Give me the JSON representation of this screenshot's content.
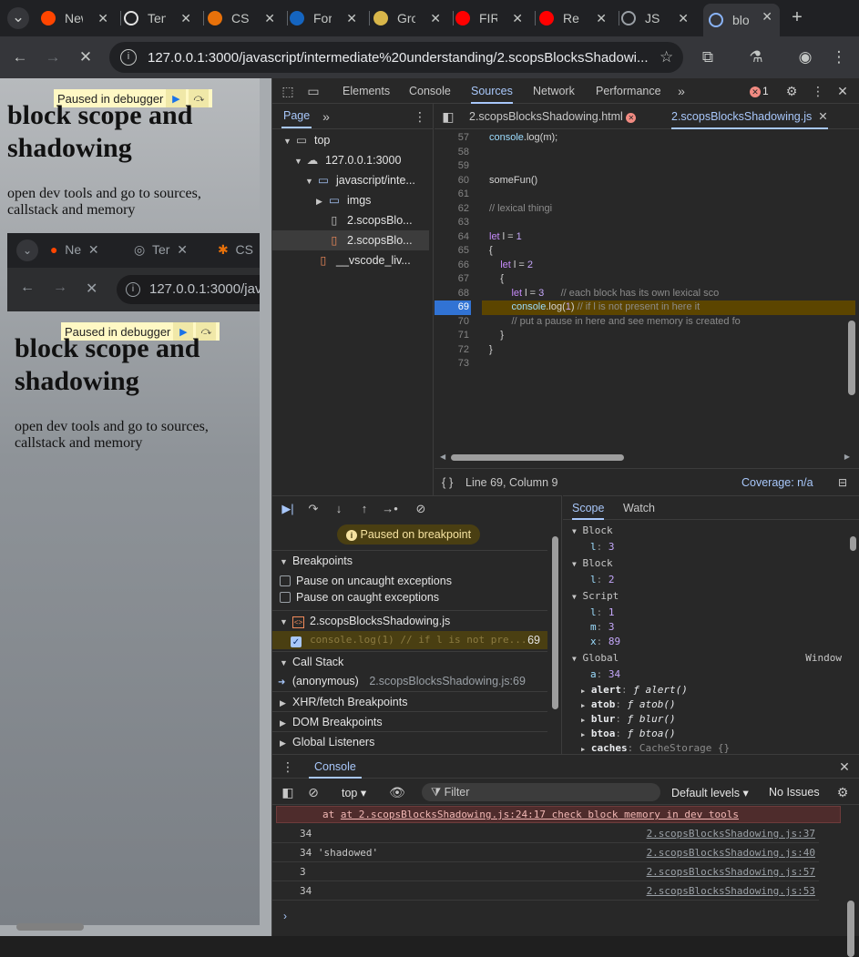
{
  "browser": {
    "tabs": [
      {
        "label": "New Tab",
        "fav": "reddit-icon",
        "color": "#ff4500"
      },
      {
        "label": "Ten",
        "fav": "openai-icon",
        "color": "#e3e3e3"
      },
      {
        "label": "CS",
        "fav": "asterisk-icon",
        "color": "#e8710a"
      },
      {
        "label": "For",
        "fav": "fs-icon",
        "color": "#1565c0"
      },
      {
        "label": "Gro",
        "fav": "bee-icon",
        "color": "#d8b64a"
      },
      {
        "label": "FIR",
        "fav": "youtube-icon",
        "color": "#ff0000"
      },
      {
        "label": "Re",
        "fav": "youtube-icon",
        "color": "#ff0000"
      },
      {
        "label": "JS",
        "fav": "globe-icon",
        "color": "#9aa0a6"
      },
      {
        "label": "blo",
        "fav": "loading-icon",
        "color": "#8ab4f8"
      }
    ],
    "url": "127.0.0.1:3000/javascript/intermediate%20understanding/2.scopsBlocksShadowi..."
  },
  "page": {
    "paused_banner": "Paused in debugger",
    "heading": "block scope and shadowing",
    "paragraph": "open dev tools and go to sources, callstack and memory",
    "nested_tabs": [
      "Ne",
      "Ter",
      "CS"
    ],
    "nested_url": "127.0.0.1:3000/jav"
  },
  "devtools": {
    "tabs": [
      "Elements",
      "Console",
      "Sources",
      "Network",
      "Performance"
    ],
    "active_tab": "Sources",
    "error_count": "1",
    "navigator": {
      "tab": "Page",
      "tree": [
        {
          "label": "top",
          "icon": "frame-icon",
          "depth": 0,
          "expanded": true
        },
        {
          "label": "127.0.0.1:3000",
          "icon": "cloud-icon",
          "depth": 1,
          "expanded": true
        },
        {
          "label": "javascript/inte...",
          "icon": "folder-icon",
          "depth": 2,
          "expanded": true
        },
        {
          "label": "imgs",
          "icon": "folder-icon",
          "depth": 3,
          "expanded": false
        },
        {
          "label": "2.scopsBlo...",
          "icon": "file-icon",
          "depth": 3
        },
        {
          "label": "2.scopsBlo...",
          "icon": "js-file-icon",
          "depth": 3,
          "selected": true
        },
        {
          "label": "__vscode_liv...",
          "icon": "js-file-icon",
          "depth": 2
        }
      ]
    },
    "editor": {
      "tabs": [
        "2.scopsBlocksShadowing.html",
        "2.scopsBlocksShadowing.js"
      ],
      "active_tab": "2.scopsBlocksShadowing.js",
      "lines": [
        {
          "n": "57",
          "code": "console.log(m);"
        },
        {
          "n": "58",
          "code": ""
        },
        {
          "n": "59",
          "code": ""
        },
        {
          "n": "60",
          "code": "someFun()"
        },
        {
          "n": "61",
          "code": ""
        },
        {
          "n": "62",
          "code": "// lexical thingi"
        },
        {
          "n": "63",
          "code": ""
        },
        {
          "n": "64",
          "code": "let l = 1"
        },
        {
          "n": "65",
          "code": "{"
        },
        {
          "n": "66",
          "code": "    let l = 2"
        },
        {
          "n": "67",
          "code": "    {"
        },
        {
          "n": "68",
          "code": "        let l = 3      // each block has its own lexical sco"
        },
        {
          "n": "69",
          "code": "        console.log(1) // if l is not present in here it"
        },
        {
          "n": "70",
          "code": "        // put a pause in here and see memory is created fo"
        },
        {
          "n": "71",
          "code": "    }"
        },
        {
          "n": "72",
          "code": "}"
        },
        {
          "n": "73",
          "code": ""
        }
      ],
      "status_position": "Line 69, Column 9",
      "coverage": "Coverage: n/a"
    },
    "debugger": {
      "paused_label": "Paused on breakpoint",
      "breakpoints_title": "Breakpoints",
      "pause_uncaught": "Pause on uncaught exceptions",
      "pause_caught": "Pause on caught exceptions",
      "bp_file": "2.scopsBlocksShadowing.js",
      "bp_code": "console.log(1) // if l is not pre...",
      "bp_line": "69",
      "callstack_title": "Call Stack",
      "frame_name": "(anonymous)",
      "frame_loc": "2.scopsBlocksShadowing.js:69",
      "xhr": "XHR/fetch Breakpoints",
      "dom": "DOM Breakpoints",
      "global": "Global Listeners"
    },
    "scope": {
      "tabs": [
        "Scope",
        "Watch"
      ],
      "rows": [
        {
          "k": "Block",
          "type": "header"
        },
        {
          "k": "l",
          "v": "3"
        },
        {
          "k": "Block",
          "type": "header"
        },
        {
          "k": "l",
          "v": "2"
        },
        {
          "k": "Script",
          "type": "header"
        },
        {
          "k": "l",
          "v": "1"
        },
        {
          "k": "m",
          "v": "3"
        },
        {
          "k": "x",
          "v": "89"
        },
        {
          "k": "Global",
          "type": "header",
          "right": "Window"
        },
        {
          "k": "a",
          "v": "34"
        },
        {
          "k": "alert",
          "v": "ƒ alert()",
          "fn": true
        },
        {
          "k": "atob",
          "v": "ƒ atob()",
          "fn": true
        },
        {
          "k": "blur",
          "v": "ƒ blur()",
          "fn": true
        },
        {
          "k": "btoa",
          "v": "ƒ btoa()",
          "fn": true
        },
        {
          "k": "caches",
          "v": "CacheStorage {}",
          "gray": true
        }
      ]
    },
    "console": {
      "title": "Console",
      "context": "top",
      "filter_placeholder": "Filter",
      "levels": "Default levels",
      "issues": "No Issues",
      "error_trace": "at 2.scopsBlocksShadowing.js:24:17 check block memory in dev tools",
      "messages": [
        {
          "text": "34",
          "src": "2.scopsBlocksShadowing.js:37"
        },
        {
          "text": "34 'shadowed'",
          "src": "2.scopsBlocksShadowing.js:40"
        },
        {
          "text": "3",
          "src": "2.scopsBlocksShadowing.js:57"
        },
        {
          "text": "34",
          "src": "2.scopsBlocksShadowing.js:53"
        }
      ]
    }
  }
}
